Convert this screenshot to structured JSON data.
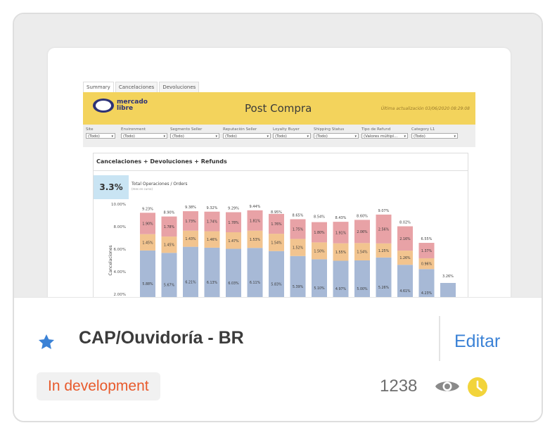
{
  "preview": {
    "tabs": [
      "Summary",
      "Cancelaciones",
      "Devoluciones"
    ],
    "logo_text": "mercado libre",
    "header_title": "Post Compra",
    "header_date": "Última actualización 03/06/2020 08:29:08",
    "filters": [
      {
        "label": "Site",
        "value": "(Todo)"
      },
      {
        "label": "Environment",
        "value": "(Todo)"
      },
      {
        "label": "Segmento Seller",
        "value": "(Todo)"
      },
      {
        "label": "Reputación Seller",
        "value": "(Todo)"
      },
      {
        "label": "Loyalty Buyer",
        "value": "(Todo)"
      },
      {
        "label": "Shipping Status",
        "value": "(Todo)"
      },
      {
        "label": "Tipo de Refund",
        "value": "(Valores múltipl..."
      },
      {
        "label": "Category L1",
        "value": "(Todo)"
      }
    ],
    "panel_title": "Cancelaciones + Devoluciones + Refunds",
    "kpi_value": "3.3%",
    "kpi_label": "Total Operaciones / Orders",
    "kpi_sub": "(mes en curso)"
  },
  "chart_data": {
    "type": "bar",
    "stacked": true,
    "ylabel": "Cancelaciones",
    "yticks": [
      "10.00%",
      "8.00%",
      "6.00%",
      "4.00%",
      "2.00%"
    ],
    "ylim": [
      1.5,
      10.5
    ],
    "totals": [
      "9.23%",
      "8.90%",
      "9.38%",
      "9.32%",
      "9.29%",
      "9.44%",
      "8.95%",
      "8.65%",
      "8.54%",
      "8.43%",
      "8.60%",
      "9.07%",
      "8.02%",
      "6.55%",
      "3.26%"
    ],
    "series": [
      {
        "values": [
          5.88,
          5.67,
          6.21,
          6.13,
          6.03,
          6.11,
          5.83,
          5.39,
          5.1,
          4.97,
          5.0,
          5.26,
          4.61,
          4.23,
          3.0
        ],
        "labels": [
          "5.88%",
          "5.67%",
          "6.21%",
          "6.13%",
          "6.03%",
          "6.11%",
          "5.83%",
          "5.39%",
          "5.10%",
          "4.97%",
          "5.00%",
          "5.26%",
          "4.61%",
          "4.23%",
          ""
        ]
      },
      {
        "values": [
          1.45,
          1.45,
          1.43,
          1.46,
          1.47,
          1.53,
          1.54,
          1.52,
          1.5,
          1.55,
          1.54,
          1.25,
          1.26,
          0.96,
          0
        ],
        "labels": [
          "1.45%",
          "1.45%",
          "1.43%",
          "1.46%",
          "1.47%",
          "1.53%",
          "1.54%",
          "1.52%",
          "1.50%",
          "1.55%",
          "1.54%",
          "1.25%",
          "1.26%",
          "0.96%",
          ""
        ]
      },
      {
        "values": [
          1.9,
          1.78,
          1.73,
          1.74,
          1.78,
          1.81,
          1.76,
          1.75,
          1.8,
          1.91,
          2.06,
          2.56,
          2.16,
          1.37,
          0
        ],
        "labels": [
          "1.90%",
          "1.78%",
          "1.73%",
          "1.74%",
          "1.78%",
          "1.81%",
          "1.76%",
          "1.75%",
          "1.80%",
          "1.91%",
          "2.06%",
          "2.56%",
          "2.16%",
          "1.37%",
          ""
        ]
      }
    ],
    "colors": [
      "#a7b9d6",
      "#f2c48f",
      "#e8a2a6"
    ]
  },
  "card": {
    "title": "CAP/Ouvidoría - BR",
    "edit_label": "Editar",
    "status": "In development",
    "views": "1238",
    "icons": {
      "favorite": "star-icon",
      "views": "eye-icon",
      "schedule": "clock-icon"
    },
    "colors": {
      "accent": "#3b82d6",
      "status": "#e85a2c",
      "clock": "#f2d43b",
      "eye": "#8a8a8a"
    }
  }
}
